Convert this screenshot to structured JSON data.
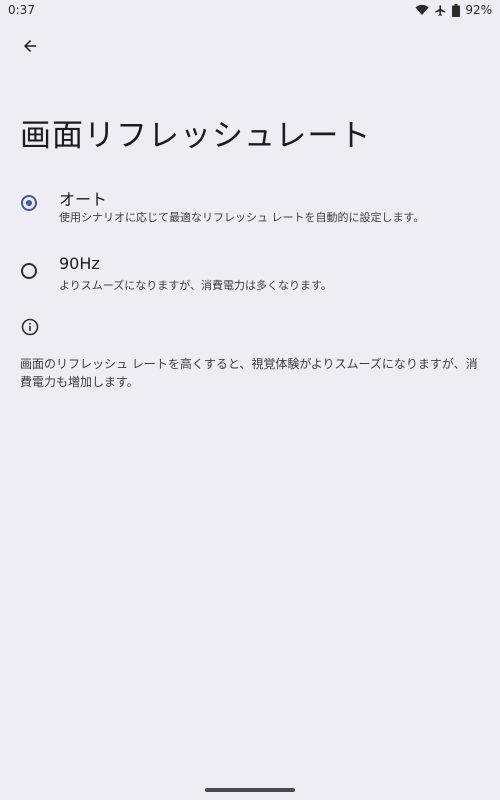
{
  "status_bar": {
    "time": "0:37",
    "battery": "92%",
    "icons": [
      "wifi-icon",
      "airplane-icon",
      "battery-icon"
    ]
  },
  "header": {
    "back_icon": "arrow-back-icon",
    "title": "画面リフレッシュレート"
  },
  "options": [
    {
      "title": "オート",
      "summary": "使用シナリオに応じて最適なリフレッシュ レートを自動的に設定します。",
      "selected": true
    },
    {
      "title": "90Hz",
      "summary": "よりスムーズになりますが、消費電力は多くなります。",
      "selected": false
    }
  ],
  "footer": {
    "info_icon": "info-icon",
    "text": "画面のリフレッシュ レートを高くすると、視覚体験がよりスムーズになりますが、消費電力も増加します。"
  },
  "colors": {
    "background": "#eeedf4",
    "accent": "#435a92",
    "text_primary": "#1c1b1f",
    "text_secondary": "#3d3d42"
  }
}
